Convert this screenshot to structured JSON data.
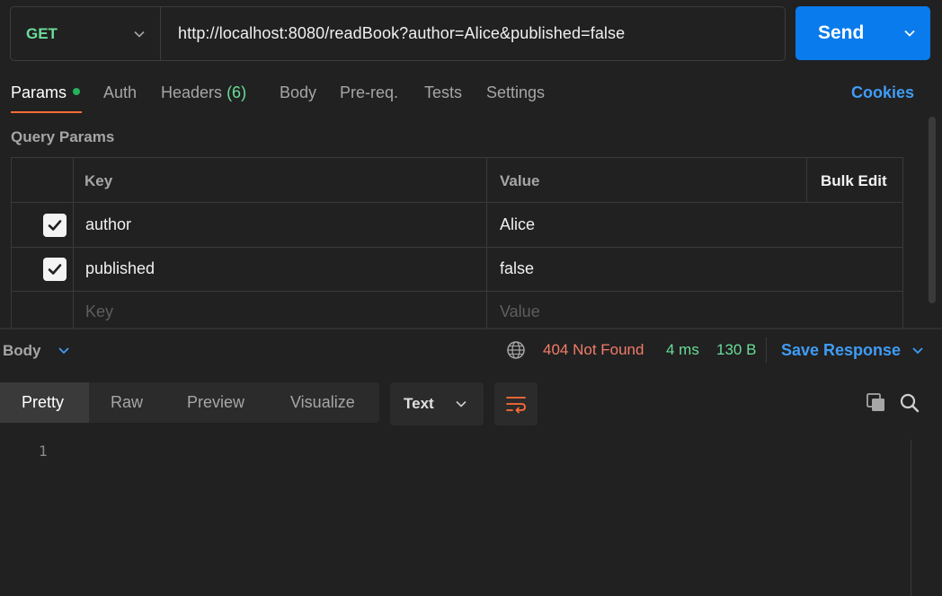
{
  "request": {
    "method": "GET",
    "url": "http://localhost:8080/readBook?author=Alice&published=false",
    "send_label": "Send"
  },
  "tabs": {
    "params": "Params",
    "auth": "Auth",
    "headers": "Headers",
    "headers_count": "(6)",
    "body": "Body",
    "prereq": "Pre-req.",
    "tests": "Tests",
    "settings": "Settings",
    "cookies": "Cookies"
  },
  "query_params": {
    "title": "Query Params",
    "col_key": "Key",
    "col_value": "Value",
    "bulk_edit": "Bulk Edit",
    "rows": [
      {
        "key": "author",
        "value": "Alice",
        "checked": true
      },
      {
        "key": "published",
        "value": "false",
        "checked": true
      }
    ],
    "placeholder_key": "Key",
    "placeholder_value": "Value"
  },
  "response": {
    "body_label": "Body",
    "status": "404 Not Found",
    "time": "4 ms",
    "size": "130 B",
    "save_response": "Save Response",
    "formats": [
      "Pretty",
      "Raw",
      "Preview",
      "Visualize"
    ],
    "active_format": "Pretty",
    "language": "Text",
    "line_number": "1"
  },
  "colors": {
    "accent_blue": "#097bed",
    "method_green": "#6bdd9a",
    "status_error": "#f27d6a",
    "tab_underline": "#ff6c37",
    "link_blue": "#3f9cf5"
  },
  "icons": [
    "chevron-down-icon",
    "globe-icon",
    "checkmark-icon",
    "wrap-lines-icon",
    "copy-icon",
    "search-icon"
  ]
}
